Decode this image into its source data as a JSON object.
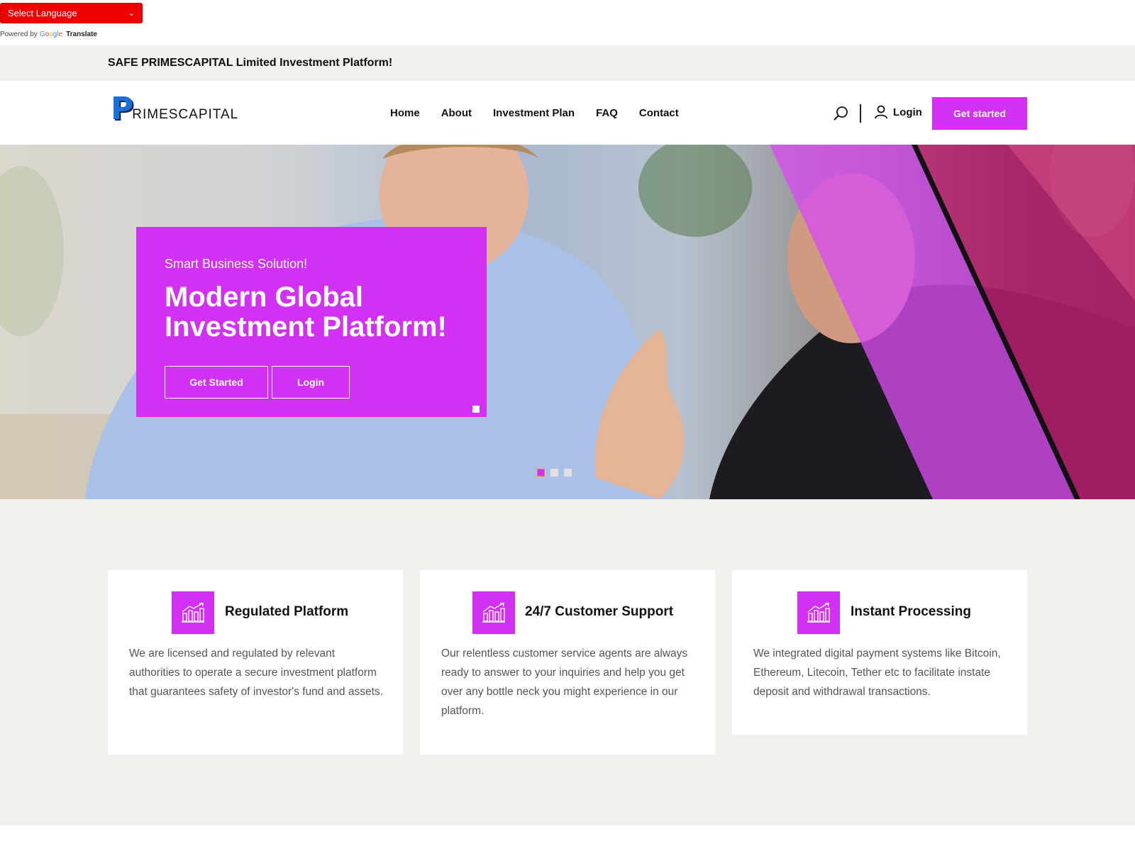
{
  "translate": {
    "select_label": "Select Language",
    "powered_by": "Powered by",
    "google": "Google",
    "translate_word": "Translate"
  },
  "topbar": {
    "text": "SAFE PRIMESCAPITAL Limited Investment Platform!"
  },
  "header": {
    "logo_letter": "P",
    "logo_rest": "RIMESCAPITAL",
    "nav": [
      "Home",
      "About",
      "Investment Plan",
      "FAQ",
      "Contact"
    ],
    "login": "Login",
    "cta": "Get started"
  },
  "hero": {
    "subtitle": "Smart Business Solution!",
    "title": "Modern Global Investment Platform!",
    "btn_primary": "Get Started",
    "btn_secondary": "Login",
    "slides": 3,
    "active_slide": 1
  },
  "features": [
    {
      "title": "Regulated Platform",
      "text": "We are licensed and regulated by relevant authorities to operate a secure investment platform that guarantees safety of investor's fund and assets.",
      "icon": "chart-growth-icon"
    },
    {
      "title": "24/7 Customer Support",
      "text": "Our relentless customer service agents are always ready to answer to your inquiries and help you get over any bottle neck you might experience in our platform.",
      "icon": "chart-growth-icon"
    },
    {
      "title": "Instant Processing",
      "text": "We integrated digital payment systems like Bitcoin, Ethereum, Litecoin, Tether etc to facilitate instate deposit and withdrawal transactions.",
      "icon": "chart-growth-icon"
    }
  ],
  "colors": {
    "accent": "#d230f5",
    "topbar_bg": "#f3f1ed",
    "lang_select": "#ee0000"
  }
}
